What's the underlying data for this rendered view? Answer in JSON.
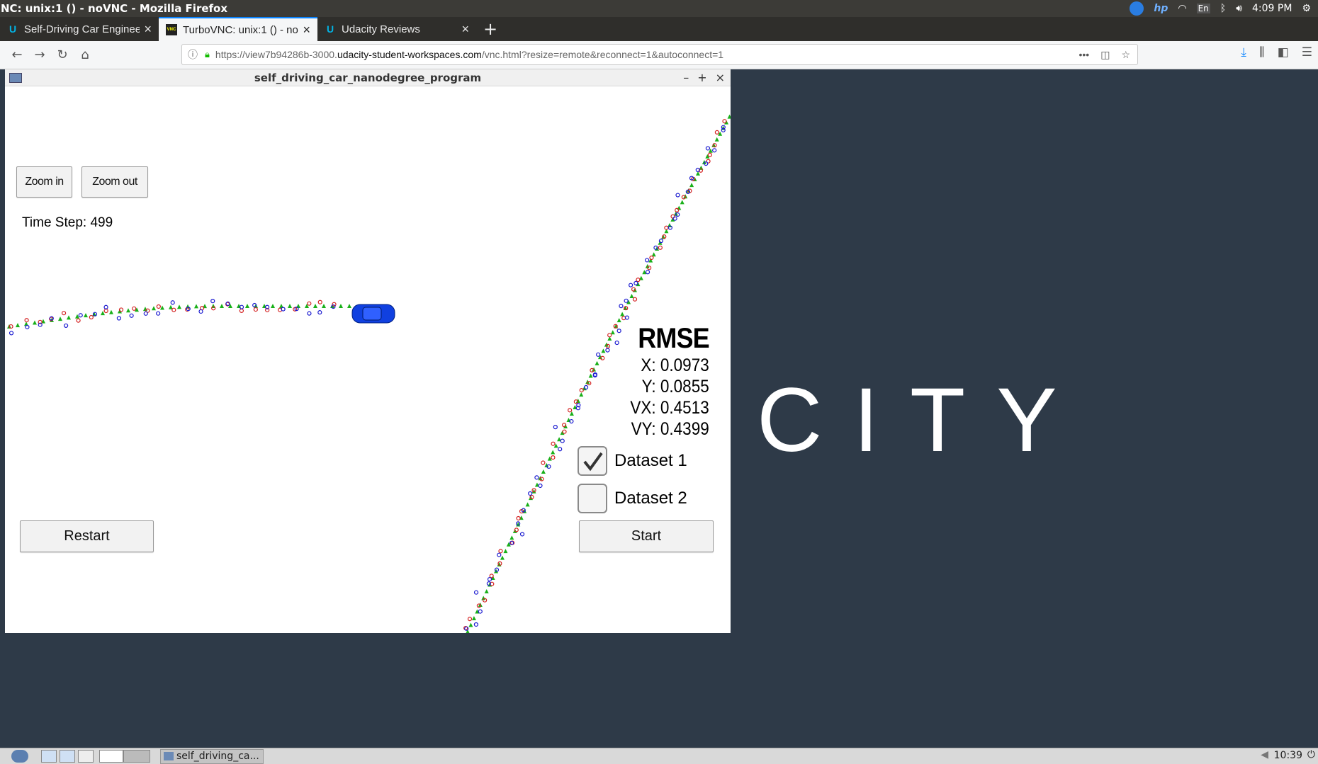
{
  "system_bar": {
    "title": "NC: unix:1 () - noVNC - Mozilla Firefox",
    "time": "4:09 PM",
    "lang": "En"
  },
  "tabs": [
    {
      "label": "Self-Driving Car Enginee",
      "favicon": "U"
    },
    {
      "label": "TurboVNC: unix:1 () - no",
      "favicon": "VNC"
    },
    {
      "label": "Udacity Reviews",
      "favicon": "U"
    }
  ],
  "new_tab": "+",
  "url": {
    "prefix": "https://view7b94286b-3000.",
    "host": "udacity-student-workspaces.com",
    "path": "/vnc.html?resize=remote&reconnect=1&autoconnect=1"
  },
  "sim": {
    "window_title": "self_driving_car_nanodegree_program",
    "zoom_in": "Zoom in",
    "zoom_out": "Zoom out",
    "time_step": "Time Step: 499",
    "rmse_title": "RMSE",
    "rmse_x": "X: 0.0973",
    "rmse_y": "Y: 0.0855",
    "rmse_vx": "VX: 0.4513",
    "rmse_vy": "VY: 0.4399",
    "dataset1": "Dataset 1",
    "dataset1_checked": true,
    "dataset2": "Dataset 2",
    "dataset2_checked": false,
    "restart": "Restart",
    "start": "Start"
  },
  "desktop_brand": "CITY",
  "taskbar": {
    "task_label": "self_driving_ca...",
    "clock": "10:39"
  },
  "colors": {
    "lidar": "#d42020",
    "radar": "#1a1ad0",
    "estimate": "#19b019",
    "car": "#1040e0"
  }
}
